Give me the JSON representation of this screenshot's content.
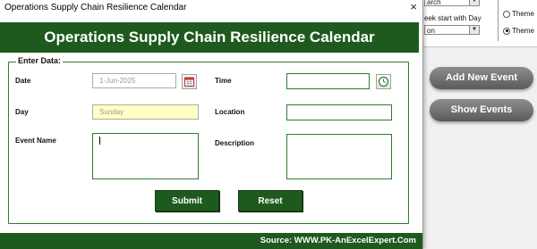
{
  "window": {
    "title": "Operations Supply Chain Resilience Calendar",
    "close_glyph": "×"
  },
  "banner": {
    "title": "Operations Supply Chain Resilience Calendar"
  },
  "form": {
    "section_title": "Enter Data:",
    "date": {
      "label": "Date",
      "value": "1-Jun-2025"
    },
    "time": {
      "label": "Time",
      "value": ""
    },
    "day": {
      "label": "Day",
      "value": "Sunday"
    },
    "location": {
      "label": "Location",
      "value": ""
    },
    "event_name": {
      "label": "Event Name",
      "value": ""
    },
    "description": {
      "label": "Description",
      "value": ""
    },
    "submit_label": "Submit",
    "reset_label": "Reset"
  },
  "footer": {
    "source": "Source: WWW.PK-AnExcelExpert.Com"
  },
  "background": {
    "dropdown_top_value": "arch",
    "week_start_label": "eek start with Day",
    "week_start_value": "on",
    "theme_options": [
      {
        "label": "Theme",
        "selected": false
      },
      {
        "label": "Theme",
        "selected": true
      }
    ],
    "add_event_label": "Add New Event",
    "show_events_label": "Show Events"
  },
  "colors": {
    "primary_green": "#1e5a1e",
    "field_border": "#2e7d32",
    "day_fill": "#ffffc6",
    "pill_gray": "#6e6e6e"
  },
  "icons": {
    "date_picker": "calendar-icon",
    "time_picker": "clock-icon"
  }
}
